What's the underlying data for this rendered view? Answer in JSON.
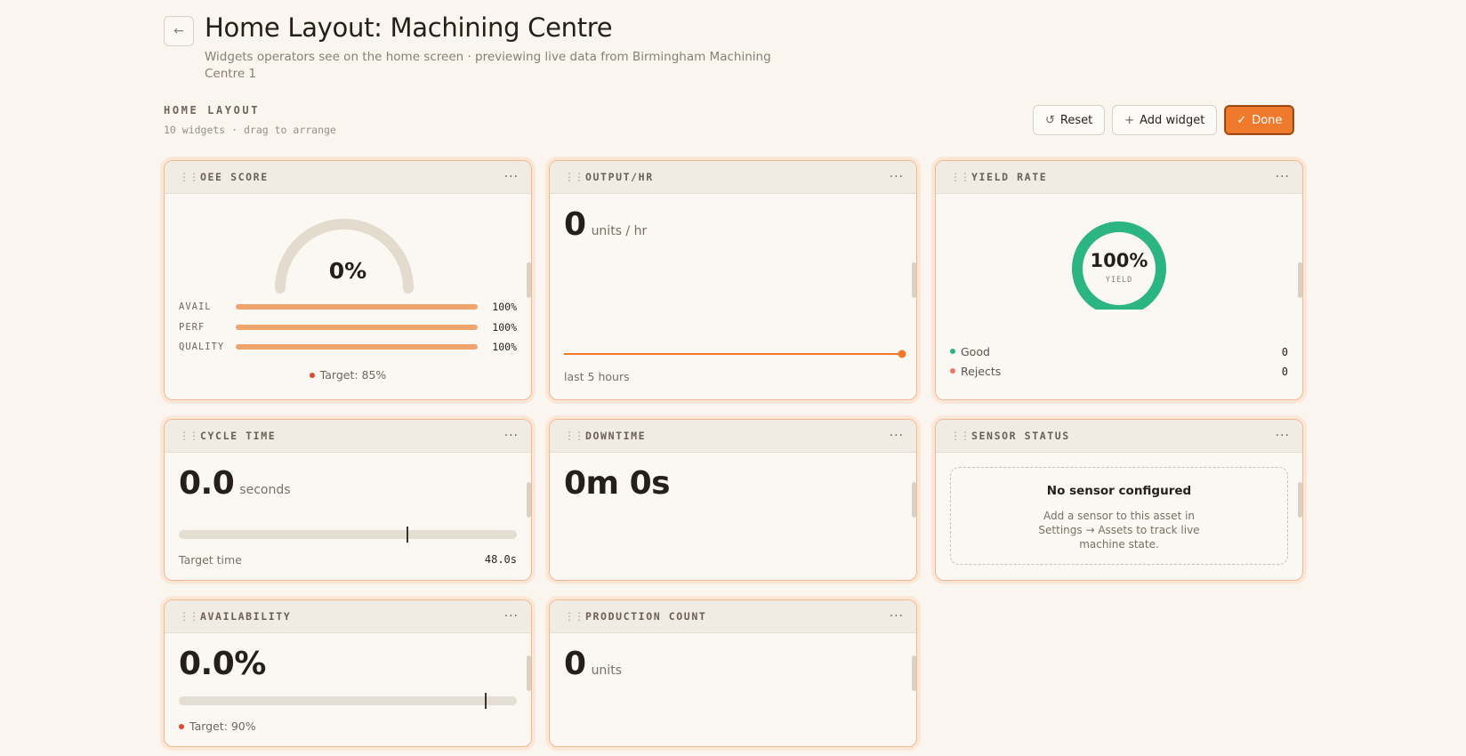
{
  "header": {
    "back_icon": "arrow-left-icon",
    "title": "Home Layout: Machining Centre",
    "subtitle": "Widgets operators see on the home screen · previewing live data from Birmingham Machining Centre 1"
  },
  "section": {
    "label": "HOME LAYOUT",
    "meta": "10 widgets · drag to arrange"
  },
  "toolbar": {
    "reset_label": "Reset",
    "add_label": "Add widget",
    "done_label": "Done"
  },
  "colors": {
    "accent": "#f07a2b",
    "bar": "#f0a46d",
    "good": "#2bb583",
    "reject": "#e8776a",
    "target_dot": "#e04a2e"
  },
  "widgets": {
    "oee": {
      "title": "OEE SCORE",
      "value": "0%",
      "gauge_fraction": 0,
      "bars": [
        {
          "label": "AVAIL",
          "value": "100%",
          "fraction": 1
        },
        {
          "label": "PERF",
          "value": "100%",
          "fraction": 1
        },
        {
          "label": "QUALITY",
          "value": "100%",
          "fraction": 1
        }
      ],
      "target": "Target: 85%"
    },
    "output": {
      "title": "OUTPUT/HR",
      "value": "0",
      "unit": "units / hr",
      "note": "last 5 hours"
    },
    "yield": {
      "title": "YIELD RATE",
      "value": "100%",
      "sub": "YIELD",
      "fraction": 1,
      "good_label": "Good",
      "good_value": "0",
      "rejects_label": "Rejects",
      "rejects_value": "0"
    },
    "cycle": {
      "title": "CYCLE TIME",
      "value": "0.0",
      "unit": "seconds",
      "marker_fraction": 0.67,
      "target_label": "Target time",
      "target_value": "48.0s"
    },
    "downtime": {
      "title": "DOWNTIME",
      "value": "0m 0s"
    },
    "sensor": {
      "title": "SENSOR STATUS",
      "empty_title": "No sensor configured",
      "empty_desc": "Add a sensor to this asset in Settings → Assets to track live machine state."
    },
    "availability": {
      "title": "AVAILABILITY",
      "value": "0.0%",
      "marker_fraction": 0.9,
      "target": "Target: 90%"
    },
    "production": {
      "title": "PRODUCTION COUNT",
      "value": "0",
      "unit": "units"
    }
  }
}
